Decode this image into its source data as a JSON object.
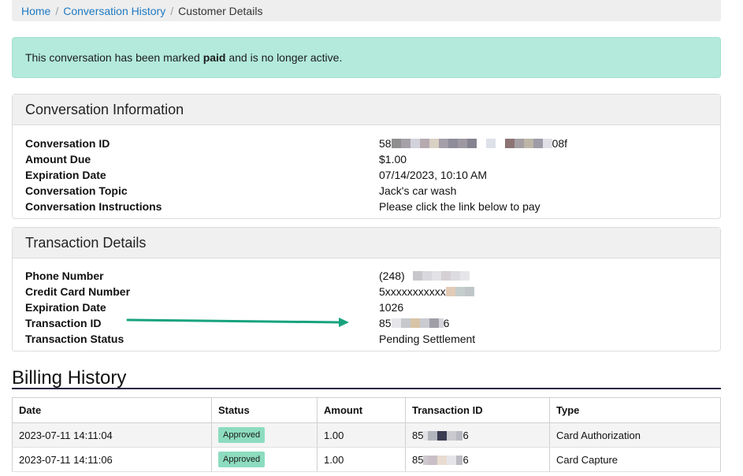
{
  "breadcrumb": {
    "home": "Home",
    "history": "Conversation History",
    "current": "Customer Details"
  },
  "alert": {
    "prefix": "This conversation has been marked ",
    "status": "paid",
    "suffix": " and is no longer active."
  },
  "conversation": {
    "title": "Conversation Information",
    "fields": [
      {
        "label": "Conversation ID",
        "value_start": "58",
        "value_end": "08f"
      },
      {
        "label": "Amount Due",
        "value": "$1.00"
      },
      {
        "label": "Expiration Date",
        "value": "07/14/2023, 10:10 AM"
      },
      {
        "label": "Conversation Topic",
        "value": "Jack's car wash"
      },
      {
        "label": "Conversation Instructions",
        "value": "Please click the link below to pay"
      }
    ]
  },
  "transaction": {
    "title": "Transaction Details",
    "fields": [
      {
        "label": "Phone Number",
        "value_start": "(248)"
      },
      {
        "label": "Credit Card Number",
        "value_start": "5xxxxxxxxxxx"
      },
      {
        "label": "Expiration Date",
        "value": "1026"
      },
      {
        "label": "Transaction ID",
        "value_start": "85",
        "value_end": "6"
      },
      {
        "label": "Transaction Status",
        "value": "Pending Settlement"
      }
    ]
  },
  "billing": {
    "title": "Billing History",
    "columns": [
      "Date",
      "Status",
      "Amount",
      "Transaction ID",
      "Type"
    ],
    "rows": [
      {
        "date": "2023-07-11 14:11:04",
        "status": "Approved",
        "amount": "1.00",
        "tx_start": "85",
        "tx_end": "6",
        "type": "Card Authorization"
      },
      {
        "date": "2023-07-11 14:11:06",
        "status": "Approved",
        "amount": "1.00",
        "tx_start": "85",
        "tx_end": "6",
        "type": "Card Capture"
      }
    ]
  },
  "colors": {
    "link": "#1f7ac2",
    "alert_bg": "#b3eadb",
    "badge_bg": "#8ddcc0",
    "arrow": "#17a37e",
    "title_underline": "#2b2544"
  }
}
